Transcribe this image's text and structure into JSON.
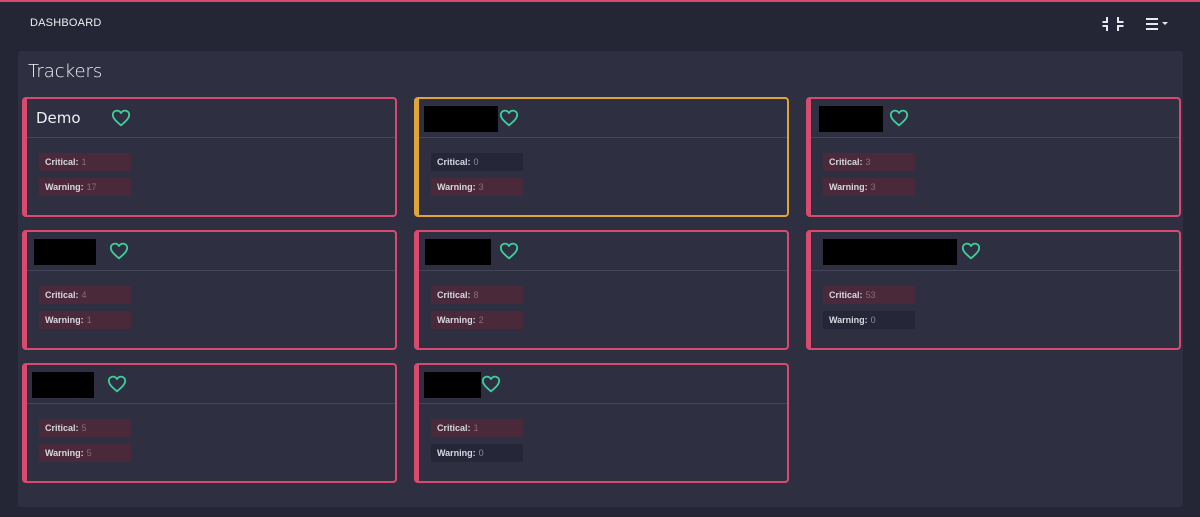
{
  "app": {
    "title": "DASHBOARD"
  },
  "controls": {
    "collapse_icon": "collapse-icon",
    "menu_icon": "hamburger-menu-icon"
  },
  "panel": {
    "title": "Trackers"
  },
  "colors": {
    "critical": "#d94b6e",
    "warning": "#e0a53a",
    "heart": "#3fcf9a"
  },
  "trackers": [
    {
      "name": "Demo",
      "redacted": false,
      "status": "critical",
      "critical_label": "Critical:",
      "critical": "1",
      "warning_label": "Warning:",
      "warning": "17"
    },
    {
      "name": "",
      "redacted": true,
      "status": "warning",
      "critical_label": "Critical:",
      "critical": "0",
      "warning_label": "Warning:",
      "warning": "3"
    },
    {
      "name": "",
      "redacted": true,
      "status": "critical",
      "critical_label": "Critical:",
      "critical": "3",
      "warning_label": "Warning:",
      "warning": "3"
    },
    {
      "name": "",
      "redacted": true,
      "status": "critical",
      "critical_label": "Critical:",
      "critical": "4",
      "warning_label": "Warning:",
      "warning": "1"
    },
    {
      "name": "",
      "redacted": true,
      "status": "critical",
      "critical_label": "Critical:",
      "critical": "8",
      "warning_label": "Warning:",
      "warning": "2"
    },
    {
      "name": "",
      "redacted": true,
      "status": "critical",
      "critical_label": "Critical:",
      "critical": "53",
      "warning_label": "Warning:",
      "warning": "0"
    },
    {
      "name": "",
      "redacted": true,
      "status": "critical",
      "critical_label": "Critical:",
      "critical": "5",
      "warning_label": "Warning:",
      "warning": "5"
    },
    {
      "name": "",
      "redacted": true,
      "status": "critical",
      "critical_label": "Critical:",
      "critical": "1",
      "warning_label": "Warning:",
      "warning": "0"
    }
  ]
}
